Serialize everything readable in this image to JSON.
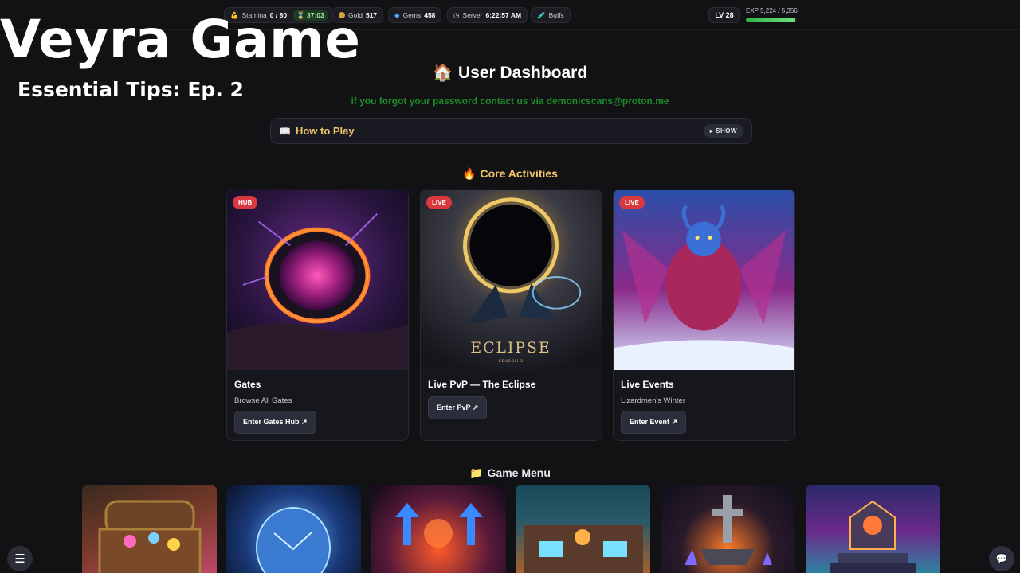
{
  "overlay": {
    "title": "Veyra Game",
    "subtitle": "Essential Tips: Ep. 2"
  },
  "topbar": {
    "stamina_label": "Stamina",
    "stamina_value": "0 / 80",
    "stamina_timer": "37:03",
    "gold_label": "Gold",
    "gold_value": "517",
    "gems_label": "Gems",
    "gems_value": "458",
    "server_label": "Server",
    "server_time": "6:22:57 AM",
    "buffs_label": "Buffs",
    "level": "LV 28",
    "exp_text": "EXP 5,224 / 5,356",
    "exp_fraction": 0.975
  },
  "dashboard": {
    "title": "User Dashboard",
    "notice": "if you forgot your password contact us via demonicscans@proton.me",
    "howto_label": "How to Play",
    "show_label": "SHOW"
  },
  "core": {
    "title": "Core Activities",
    "cards": [
      {
        "badge": "HUB",
        "title": "Gates",
        "subtitle": "Browse All Gates",
        "button": "Enter Gates Hub ↗",
        "image": "portal-art"
      },
      {
        "badge": "LIVE",
        "title": "Live PvP — The Eclipse",
        "subtitle": "",
        "button": "Enter PvP ↗",
        "image": "eclipse-art",
        "art_text": "ECLIPSE",
        "art_subtext": "SEASON 3"
      },
      {
        "badge": "LIVE",
        "title": "Live Events",
        "subtitle": "Lizardmen's Winter",
        "button": "Enter Event ↗",
        "image": "demon-art"
      }
    ]
  },
  "menu": {
    "title": "Game Menu",
    "tiles": [
      "treasure-chest-art",
      "egg-art",
      "arrows-art",
      "shop-art",
      "anvil-art",
      "shrine-art"
    ]
  },
  "colors": {
    "accent_gold": "#f1c56a",
    "notice_green": "#1f8a2a",
    "badge_red": "#d9383e",
    "exp_green": "#35b24a"
  }
}
